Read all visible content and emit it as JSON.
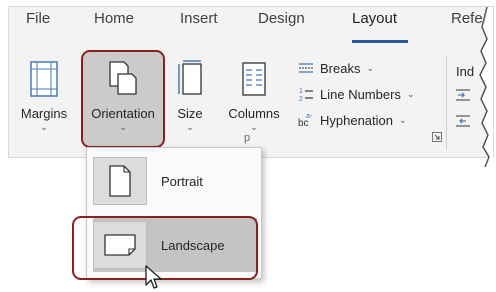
{
  "ribbon": {
    "tabs": [
      "File",
      "Home",
      "Insert",
      "Design",
      "Layout",
      "Refe"
    ],
    "active_tab": "Layout",
    "page_setup": {
      "margins": "Margins",
      "orientation": "Orientation",
      "size": "Size",
      "columns": "Columns",
      "breaks": "Breaks",
      "line_numbers": "Line Numbers",
      "hyphenation": "Hyphenation",
      "group_label": "p",
      "indent_partial": "Ind"
    }
  },
  "orientation_menu": {
    "items": [
      {
        "label": "Portrait",
        "icon": "portrait-page-icon"
      },
      {
        "label": "Landscape",
        "icon": "landscape-page-icon"
      }
    ],
    "hovered": "Landscape"
  },
  "colors": {
    "accent": "#2b579a",
    "highlight": "#8b2020",
    "ribbon_bg": "#f3f3f3"
  }
}
